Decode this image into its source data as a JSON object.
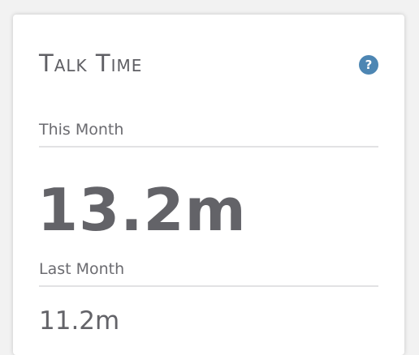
{
  "card": {
    "title": "Talk Time",
    "help_icon": "question-mark-icon",
    "help_glyph": "?",
    "help_color": "#4d86b3",
    "this_month": {
      "label": "This Month",
      "value": "13.2m"
    },
    "last_month": {
      "label": "Last Month",
      "value": "11.2m"
    }
  }
}
